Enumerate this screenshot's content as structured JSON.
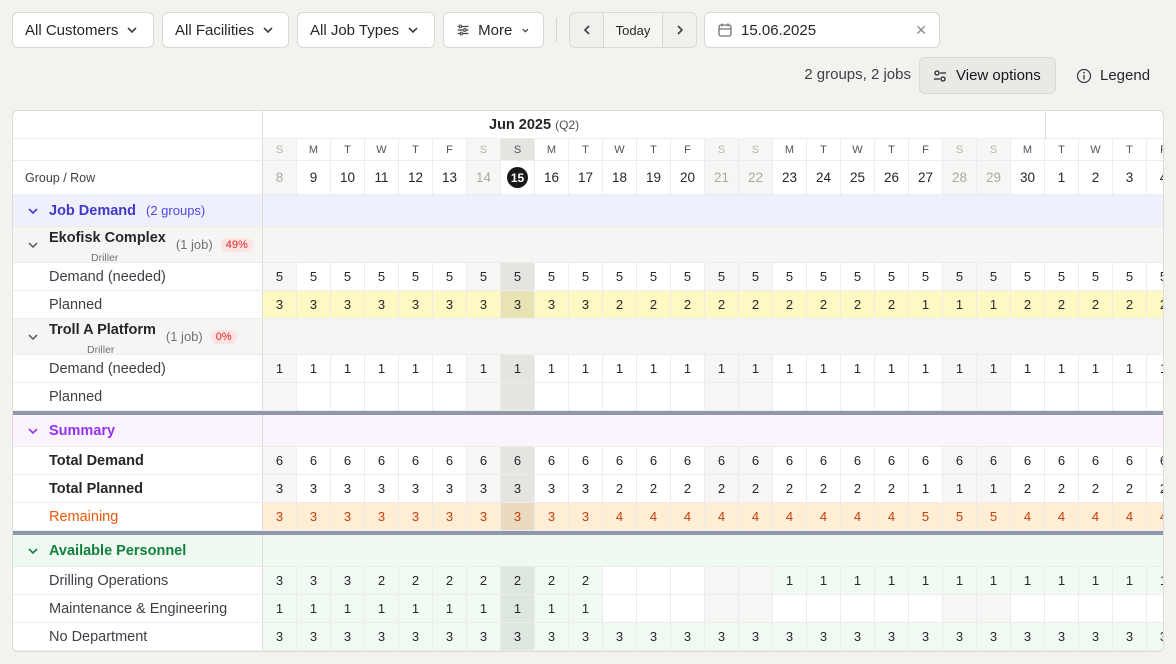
{
  "toolbar": {
    "customers": "All Customers",
    "facilities": "All Facilities",
    "job_types": "All Job Types",
    "more": "More",
    "today": "Today",
    "date_value": "15.06.2025",
    "summary": "2 groups, 2 jobs",
    "view_options": "View options",
    "legend": "Legend"
  },
  "grid": {
    "month_label": "Jun 2025",
    "quarter_label": "(Q2)",
    "header_label": "Group / Row",
    "days": [
      {
        "dow": "S",
        "d": "8",
        "w": true
      },
      {
        "dow": "M",
        "d": "9"
      },
      {
        "dow": "T",
        "d": "10"
      },
      {
        "dow": "W",
        "d": "11"
      },
      {
        "dow": "T",
        "d": "12"
      },
      {
        "dow": "F",
        "d": "13"
      },
      {
        "dow": "S",
        "d": "14",
        "w": true
      },
      {
        "dow": "S",
        "d": "15",
        "today": true
      },
      {
        "dow": "M",
        "d": "16"
      },
      {
        "dow": "T",
        "d": "17"
      },
      {
        "dow": "W",
        "d": "18"
      },
      {
        "dow": "T",
        "d": "19"
      },
      {
        "dow": "F",
        "d": "20"
      },
      {
        "dow": "S",
        "d": "21",
        "w": true
      },
      {
        "dow": "S",
        "d": "22",
        "w": true
      },
      {
        "dow": "M",
        "d": "23"
      },
      {
        "dow": "T",
        "d": "24"
      },
      {
        "dow": "W",
        "d": "25"
      },
      {
        "dow": "T",
        "d": "26"
      },
      {
        "dow": "F",
        "d": "27"
      },
      {
        "dow": "S",
        "d": "28",
        "w": true
      },
      {
        "dow": "S",
        "d": "29",
        "w": true
      },
      {
        "dow": "M",
        "d": "30"
      },
      {
        "dow": "T",
        "d": "1"
      },
      {
        "dow": "W",
        "d": "2"
      },
      {
        "dow": "T",
        "d": "3"
      },
      {
        "dow": "F",
        "d": "4"
      }
    ],
    "job_demand": {
      "label": "Job Demand",
      "count": "(2 groups)"
    },
    "groups": [
      {
        "name": "Ekofisk Complex",
        "role": "Driller",
        "count": "(1 job)",
        "pct": "49%",
        "demand_label": "Demand (needed)",
        "demand": [
          "5",
          "5",
          "5",
          "5",
          "5",
          "5",
          "5",
          "5",
          "5",
          "5",
          "5",
          "5",
          "5",
          "5",
          "5",
          "5",
          "5",
          "5",
          "5",
          "5",
          "5",
          "5",
          "5",
          "5",
          "5",
          "5",
          "5"
        ],
        "planned_label": "Planned",
        "planned": [
          "3",
          "3",
          "3",
          "3",
          "3",
          "3",
          "3",
          "3",
          "3",
          "3",
          "2",
          "2",
          "2",
          "2",
          "2",
          "2",
          "2",
          "2",
          "2",
          "1",
          "1",
          "1",
          "2",
          "2",
          "2",
          "2",
          "2"
        ]
      },
      {
        "name": "Troll A Platform",
        "role": "Driller",
        "count": "(1 job)",
        "pct": "0%",
        "demand_label": "Demand (needed)",
        "demand": [
          "1",
          "1",
          "1",
          "1",
          "1",
          "1",
          "1",
          "1",
          "1",
          "1",
          "1",
          "1",
          "1",
          "1",
          "1",
          "1",
          "1",
          "1",
          "1",
          "1",
          "1",
          "1",
          "1",
          "1",
          "1",
          "1",
          "1"
        ],
        "planned_label": "Planned",
        "planned": [
          "",
          "",
          "",
          "",
          "",
          "",
          "",
          "",
          "",
          "",
          "",
          "",
          "",
          "",
          "",
          "",
          "",
          "",
          "",
          "",
          "",
          "",
          "",
          "",
          "",
          "",
          ""
        ]
      }
    ],
    "summary": {
      "label": "Summary",
      "total_demand_label": "Total Demand",
      "total_demand": [
        "6",
        "6",
        "6",
        "6",
        "6",
        "6",
        "6",
        "6",
        "6",
        "6",
        "6",
        "6",
        "6",
        "6",
        "6",
        "6",
        "6",
        "6",
        "6",
        "6",
        "6",
        "6",
        "6",
        "6",
        "6",
        "6",
        "6"
      ],
      "total_planned_label": "Total Planned",
      "total_planned": [
        "3",
        "3",
        "3",
        "3",
        "3",
        "3",
        "3",
        "3",
        "3",
        "3",
        "2",
        "2",
        "2",
        "2",
        "2",
        "2",
        "2",
        "2",
        "2",
        "1",
        "1",
        "1",
        "2",
        "2",
        "2",
        "2",
        "2"
      ],
      "remaining_label": "Remaining",
      "remaining": [
        "3",
        "3",
        "3",
        "3",
        "3",
        "3",
        "3",
        "3",
        "3",
        "3",
        "4",
        "4",
        "4",
        "4",
        "4",
        "4",
        "4",
        "4",
        "4",
        "5",
        "5",
        "5",
        "4",
        "4",
        "4",
        "4",
        "4"
      ]
    },
    "personnel": {
      "label": "Available Personnel",
      "rows": [
        {
          "label": "Drilling Operations",
          "vals": [
            "3",
            "3",
            "3",
            "2",
            "2",
            "2",
            "2",
            "2",
            "2",
            "2",
            "",
            "",
            "",
            "",
            "",
            "1",
            "1",
            "1",
            "1",
            "1",
            "1",
            "1",
            "1",
            "1",
            "1",
            "1",
            "1"
          ]
        },
        {
          "label": "Maintenance & Engineering",
          "vals": [
            "1",
            "1",
            "1",
            "1",
            "1",
            "1",
            "1",
            "1",
            "1",
            "1",
            "",
            "",
            "",
            "",
            "",
            "",
            "",
            "",
            "",
            "",
            "",
            "",
            "",
            "",
            "",
            "",
            ""
          ]
        },
        {
          "label": "No Department",
          "vals": [
            "3",
            "3",
            "3",
            "3",
            "3",
            "3",
            "3",
            "3",
            "3",
            "3",
            "3",
            "3",
            "3",
            "3",
            "3",
            "3",
            "3",
            "3",
            "3",
            "3",
            "3",
            "3",
            "3",
            "3",
            "3",
            "3",
            "3"
          ]
        }
      ]
    }
  }
}
